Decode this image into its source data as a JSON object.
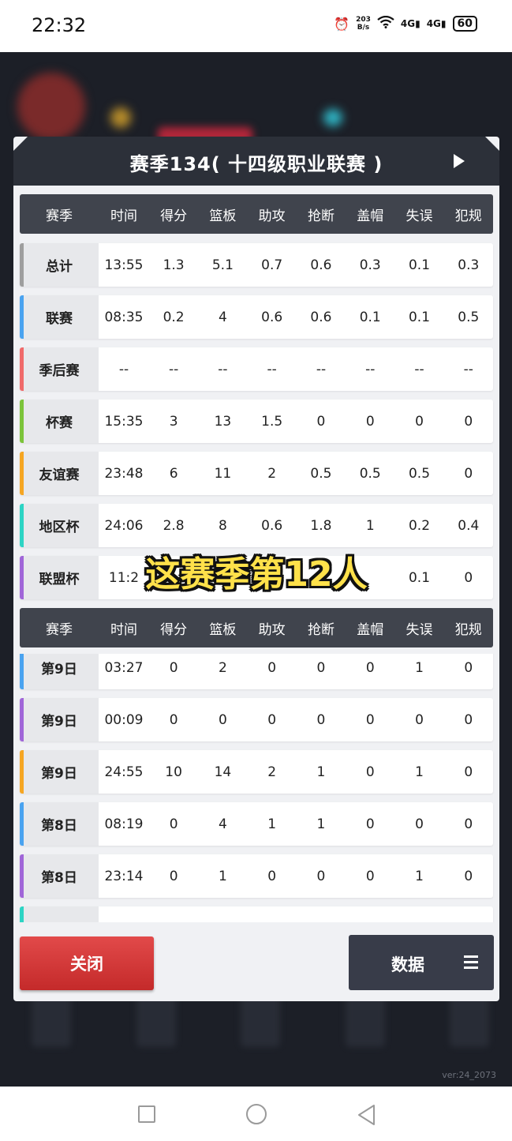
{
  "status_bar": {
    "time": "22:32",
    "net_speed_value": "203",
    "net_speed_unit": "B/s",
    "signal1": "4G",
    "signal2": "4G",
    "battery": "60"
  },
  "modal": {
    "title": "赛季134( 十四级职业联赛 )",
    "columns": [
      "赛季",
      "时间",
      "得分",
      "篮板",
      "助攻",
      "抢断",
      "盖帽",
      "失误",
      "犯规"
    ],
    "summary_rows": [
      {
        "label": "总计",
        "stripe": "#9e9e9e",
        "cells": [
          "13:55",
          "1.3",
          "5.1",
          "0.7",
          "0.6",
          "0.3",
          "0.1",
          "0.3"
        ]
      },
      {
        "label": "联赛",
        "stripe": "#4aa3f0",
        "cells": [
          "08:35",
          "0.2",
          "4",
          "0.6",
          "0.6",
          "0.1",
          "0.1",
          "0.5"
        ]
      },
      {
        "label": "季后赛",
        "stripe": "#f06a6a",
        "cells": [
          "--",
          "--",
          "--",
          "--",
          "--",
          "--",
          "--",
          "--"
        ]
      },
      {
        "label": "杯赛",
        "stripe": "#7cc43a",
        "cells": [
          "15:35",
          "3",
          "13",
          "1.5",
          "0",
          "0",
          "0",
          "0"
        ]
      },
      {
        "label": "友谊赛",
        "stripe": "#f5a623",
        "cells": [
          "23:48",
          "6",
          "11",
          "2",
          "0.5",
          "0.5",
          "0.5",
          "0"
        ]
      },
      {
        "label": "地区杯",
        "stripe": "#2dd4c4",
        "cells": [
          "24:06",
          "2.8",
          "8",
          "0.6",
          "1.8",
          "1",
          "0.2",
          "0.4"
        ]
      },
      {
        "label": "联盟杯",
        "stripe": "#a066d8",
        "cells": [
          "11:2",
          "",
          "",
          "",
          "",
          "",
          "0.1",
          "0"
        ]
      }
    ],
    "game_rows": [
      {
        "label": "第9日",
        "stripe": "#4aa3f0",
        "cells": [
          "03:27",
          "0",
          "2",
          "0",
          "0",
          "0",
          "1",
          "0"
        ]
      },
      {
        "label": "第9日",
        "stripe": "#a066d8",
        "cells": [
          "00:09",
          "0",
          "0",
          "0",
          "0",
          "0",
          "0",
          "0"
        ]
      },
      {
        "label": "第9日",
        "stripe": "#f5a623",
        "cells": [
          "24:55",
          "10",
          "14",
          "2",
          "1",
          "0",
          "1",
          "0"
        ]
      },
      {
        "label": "第8日",
        "stripe": "#4aa3f0",
        "cells": [
          "08:19",
          "0",
          "4",
          "1",
          "1",
          "0",
          "0",
          "0"
        ]
      },
      {
        "label": "第8日",
        "stripe": "#a066d8",
        "cells": [
          "23:14",
          "0",
          "1",
          "0",
          "0",
          "0",
          "1",
          "0"
        ]
      },
      {
        "label": "",
        "stripe": "#2dd4c4",
        "cells": [
          "",
          "",
          "",
          "",
          "",
          "",
          "",
          ""
        ]
      }
    ],
    "close_label": "关闭",
    "data_label": "数据"
  },
  "overlay_caption": "这赛季第12人",
  "version": "ver:24_2073"
}
